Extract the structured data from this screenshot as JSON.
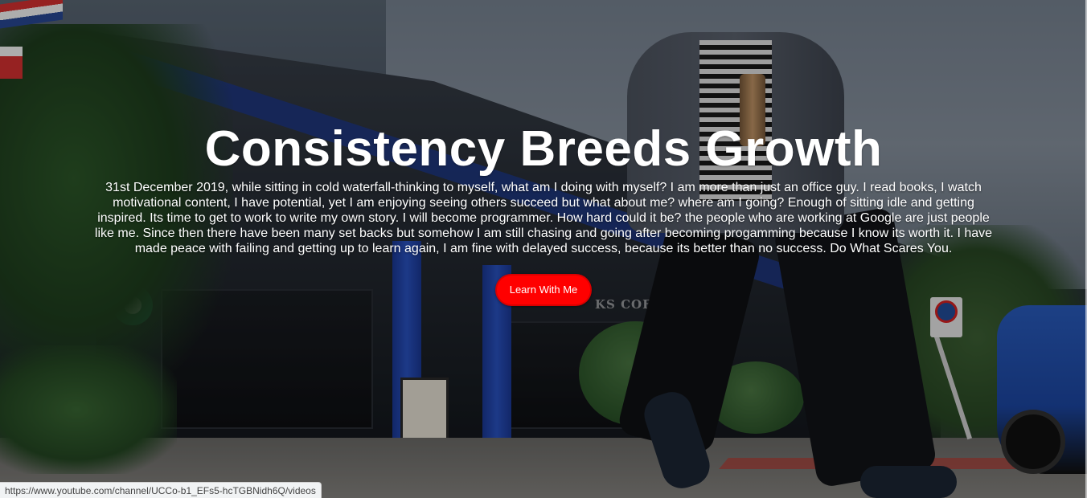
{
  "hero": {
    "title": "Consistency Breeds Growth",
    "story": "31st December 2019, while sitting in cold waterfall-thinking to myself, what am I doing with myself? I am more than just an office guy. I read books, I watch motivational content, I have potential, yet I am enjoying seeing others succeed but what about me? where am I going? Enough of sitting idle and getting inspired. Its time to get to work to write my own story. I will become programmer. How hard could it be? the people who are working at Google are just people like me. Since then there have been many set backs but somehow I am still chasing and going after becoming progamming because I know its worth it. I have made peace with failing and getting up to learn again, I am fine with delayed success, because its better than no success. Do What Scares You.",
    "cta_label": "Learn With Me",
    "background_sign_text": "KS COFFEE"
  },
  "status_bar": {
    "url": "https://www.youtube.com/channel/UCCo-b1_EFs5-hcTGBNidh6Q/videos"
  },
  "colors": {
    "cta_background": "#ff0000",
    "text": "#ffffff"
  }
}
